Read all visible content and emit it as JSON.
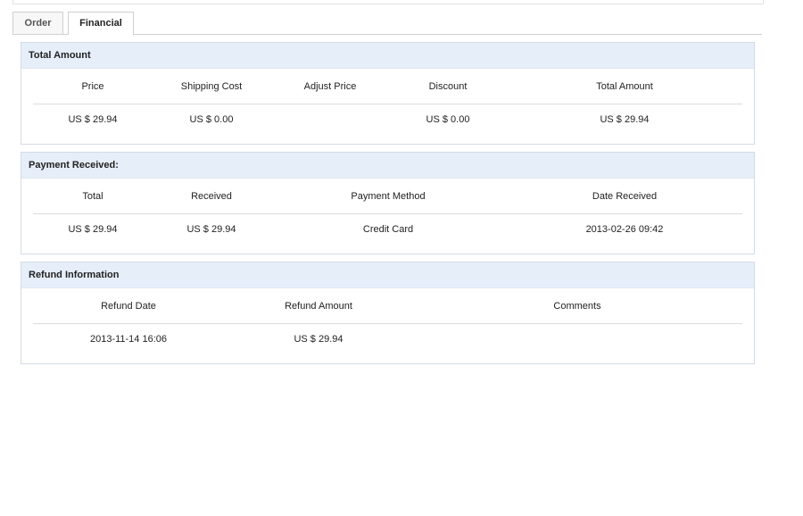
{
  "tabs": {
    "order": "Order",
    "financial": "Financial"
  },
  "total_amount": {
    "title": "Total Amount",
    "headers": [
      "Price",
      "Shipping Cost",
      "Adjust Price",
      "Discount",
      "Total Amount"
    ],
    "values": [
      "US $ 29.94",
      "US $ 0.00",
      "",
      "US $ 0.00",
      "US $ 29.94"
    ]
  },
  "payment_received": {
    "title": "Payment Received:",
    "headers": [
      "Total",
      "Received",
      "Payment Method",
      "Date Received"
    ],
    "values": [
      "US $ 29.94",
      "US $ 29.94",
      "Credit Card",
      "2013-02-26 09:42"
    ]
  },
  "refund_information": {
    "title": "Refund Information",
    "headers": [
      "Refund Date",
      "Refund Amount",
      "Comments"
    ],
    "values": [
      "2013-11-14 16:06",
      "US $ 29.94",
      ""
    ]
  }
}
